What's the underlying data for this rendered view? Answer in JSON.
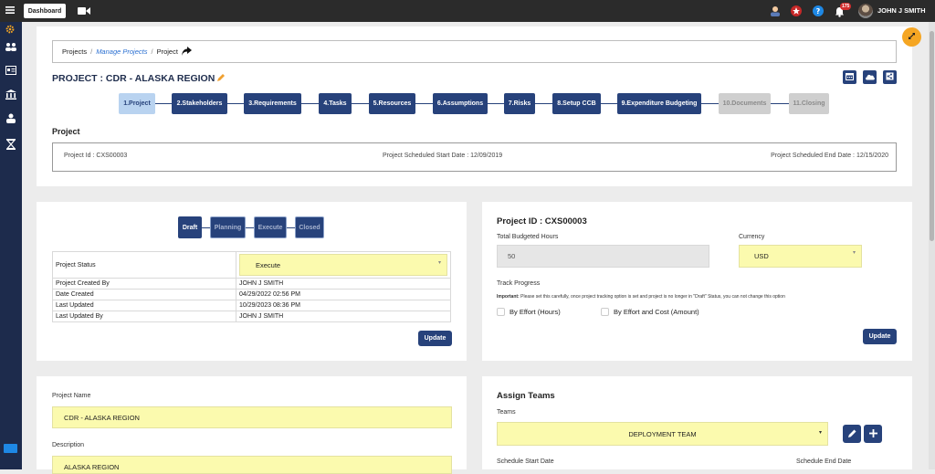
{
  "topbar": {
    "dashboard_label": "Dashboard",
    "notification_count": "175",
    "user_name": "JOHN J SMITH"
  },
  "breadcrumb": {
    "items": [
      "Projects",
      "Manage Projects",
      "Project"
    ],
    "sep": "/"
  },
  "project": {
    "title": "PROJECT : CDR - ALASKA REGION",
    "steps": [
      "1.Project",
      "2.Stakeholders",
      "3.Requirements",
      "4.Tasks",
      "5.Resources",
      "6.Assumptions",
      "7.Risks",
      "8.Setup CCB",
      "9.Expenditure Budgeting",
      "10.Documents",
      "11.Closing"
    ],
    "section_title": "Project",
    "id_text": "Project Id : CXS00003",
    "start_text": "Project Scheduled Start Date : 12/09/2019",
    "end_text": "Project Scheduled End Date : 12/15/2020"
  },
  "status_card": {
    "stages": [
      "Draft",
      "Planning",
      "Execute",
      "Closed"
    ],
    "rows": [
      {
        "label": "Project Status",
        "value": "Execute"
      },
      {
        "label": "Project Created By",
        "value": "JOHN J SMITH"
      },
      {
        "label": "Date Created",
        "value": "04/29/2022 02:56 PM"
      },
      {
        "label": "Last Updated",
        "value": "10/29/2023 08:36 PM"
      },
      {
        "label": "Last Updated By",
        "value": "JOHN J SMITH"
      }
    ],
    "update_label": "Update"
  },
  "budget_card": {
    "title": "Project ID : CXS00003",
    "hours_label": "Total Budgeted Hours",
    "hours_value": "50",
    "currency_label": "Currency",
    "currency_value": "USD",
    "track_label": "Track Progress",
    "important_label": "Important:",
    "important_text": "Please set this carefully, once project tracking option is set and project is no longer in \"Draft\" Status, you can not change this option",
    "option1": "By Effort (Hours)",
    "option2": "By Effort and Cost (Amount)",
    "update_label": "Update"
  },
  "name_card": {
    "name_label": "Project Name",
    "name_value": "CDR - ALASKA REGION",
    "desc_label": "Description",
    "desc_value": "ALASKA REGION"
  },
  "teams_card": {
    "title": "Assign Teams",
    "teams_label": "Teams",
    "teams_value": "DEPLOYMENT TEAM",
    "start_label": "Schedule Start Date",
    "end_label": "Schedule End Date"
  },
  "colors": {
    "navy": "#27427b",
    "sidebar": "#1d2b4c",
    "topbar": "#2b2b2b",
    "yellow_field": "#fbfaae",
    "fab": "#f5a623"
  }
}
